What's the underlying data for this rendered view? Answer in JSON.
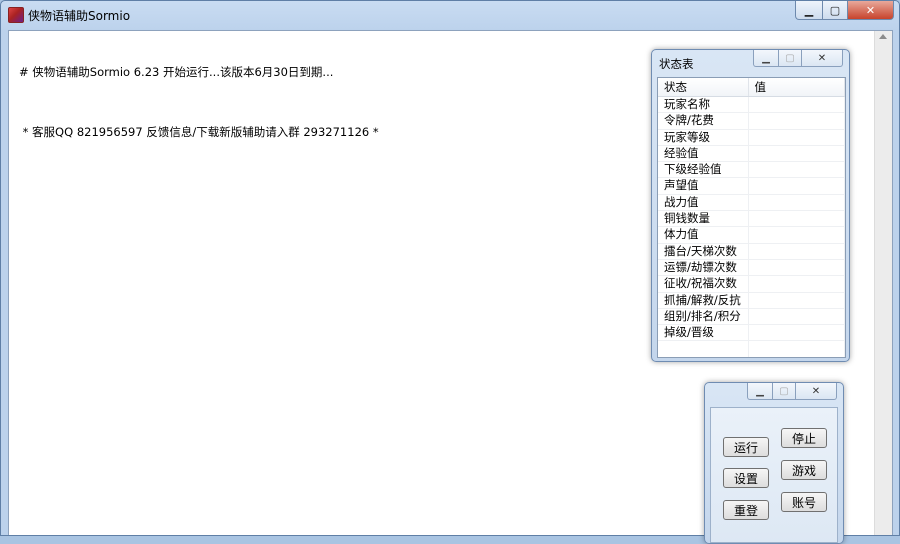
{
  "window": {
    "title": "侠物语辅助Sormio"
  },
  "log": [
    "# 侠物语辅助Sormio 6.23 开始运行...该版本6月30日到期...",
    " * 客服QQ 821956597 反馈信息/下载新版辅助请入群 293271126 *"
  ],
  "status_panel": {
    "title": "状态表",
    "columns": [
      "状态",
      "值"
    ],
    "rows": [
      {
        "label": "玩家名称",
        "value": ""
      },
      {
        "label": "令牌/花费",
        "value": ""
      },
      {
        "label": "玩家等级",
        "value": ""
      },
      {
        "label": "经验值",
        "value": ""
      },
      {
        "label": "下级经验值",
        "value": ""
      },
      {
        "label": "声望值",
        "value": ""
      },
      {
        "label": "战力值",
        "value": ""
      },
      {
        "label": "铜钱数量",
        "value": ""
      },
      {
        "label": "体力值",
        "value": ""
      },
      {
        "label": "擂台/天梯次数",
        "value": ""
      },
      {
        "label": "运镖/劫镖次数",
        "value": ""
      },
      {
        "label": "征收/祝福次数",
        "value": ""
      },
      {
        "label": "抓捕/解救/反抗",
        "value": ""
      },
      {
        "label": "组别/排名/积分",
        "value": ""
      },
      {
        "label": "掉级/晋级",
        "value": ""
      }
    ]
  },
  "controls": {
    "run": "运行",
    "stop": "停止",
    "settings": "设置",
    "game": "游戏",
    "relogin": "重登",
    "account": "账号"
  },
  "colors": {
    "close_button": "#c7432c",
    "title_bar": "#bcd2ec"
  }
}
